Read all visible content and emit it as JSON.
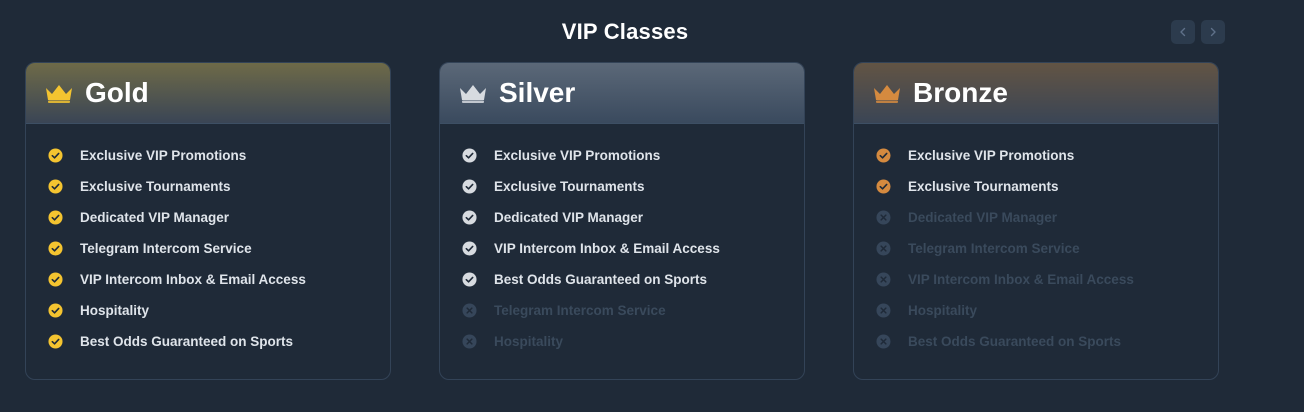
{
  "page": {
    "title": "VIP Classes"
  },
  "nav": {
    "prev_icon": "chevron-left-icon",
    "next_icon": "chevron-right-icon"
  },
  "colors": {
    "background": "#1f2a38",
    "gold": "#f4c430",
    "silver": "#d7dbe0",
    "bronze": "#d58a3f",
    "disabled": "#36465a"
  },
  "tiers": [
    {
      "name": "Gold",
      "icon": "crown-icon",
      "features": [
        {
          "label": "Exclusive VIP Promotions",
          "included": true
        },
        {
          "label": "Exclusive Tournaments",
          "included": true
        },
        {
          "label": "Dedicated VIP Manager",
          "included": true
        },
        {
          "label": "Telegram Intercom Service",
          "included": true
        },
        {
          "label": "VIP Intercom Inbox & Email Access",
          "included": true
        },
        {
          "label": "Hospitality",
          "included": true
        },
        {
          "label": "Best Odds Guaranteed on Sports",
          "included": true
        }
      ]
    },
    {
      "name": "Silver",
      "icon": "crown-icon",
      "features": [
        {
          "label": "Exclusive VIP Promotions",
          "included": true
        },
        {
          "label": "Exclusive Tournaments",
          "included": true
        },
        {
          "label": "Dedicated VIP Manager",
          "included": true
        },
        {
          "label": "VIP Intercom Inbox & Email Access",
          "included": true
        },
        {
          "label": "Best Odds Guaranteed on Sports",
          "included": true
        },
        {
          "label": "Telegram Intercom Service",
          "included": false
        },
        {
          "label": "Hospitality",
          "included": false
        }
      ]
    },
    {
      "name": "Bronze",
      "icon": "crown-icon",
      "features": [
        {
          "label": "Exclusive VIP Promotions",
          "included": true
        },
        {
          "label": "Exclusive Tournaments",
          "included": true
        },
        {
          "label": "Dedicated VIP Manager",
          "included": false
        },
        {
          "label": "Telegram Intercom Service",
          "included": false
        },
        {
          "label": "VIP Intercom Inbox & Email Access",
          "included": false
        },
        {
          "label": "Hospitality",
          "included": false
        },
        {
          "label": "Best Odds Guaranteed on Sports",
          "included": false
        }
      ]
    }
  ]
}
